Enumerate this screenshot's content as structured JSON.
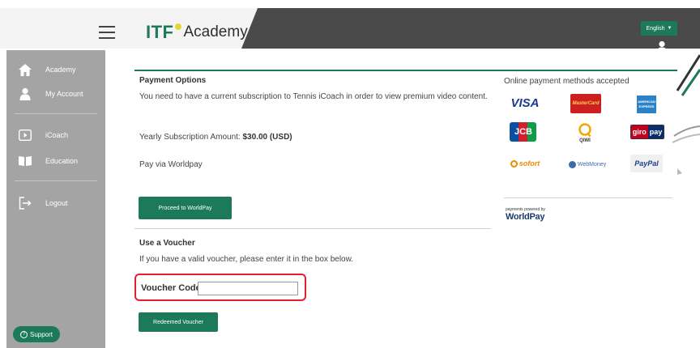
{
  "header": {
    "logo_itf": "ITF",
    "logo_academy": "Academy",
    "language": "English"
  },
  "sidebar": {
    "items": [
      {
        "label": "Academy",
        "icon": "home-icon"
      },
      {
        "label": "My Account",
        "icon": "user-icon"
      },
      {
        "label": "iCoach",
        "icon": "play-icon"
      },
      {
        "label": "Education",
        "icon": "book-icon"
      },
      {
        "label": "Logout",
        "icon": "logout-icon"
      }
    ],
    "support_label": "Support"
  },
  "payment": {
    "title": "Payment Options",
    "description": "You need to have a current subscription to Tennis iCoach in order to view premium video content.",
    "amount_label": "Yearly Subscription Amount: ",
    "amount_value": "$30.00 (USD)",
    "pay_via": "Pay via Worldpay",
    "proceed_button": "Proceed to WorldPay"
  },
  "methods": {
    "title": "Online payment methods accepted",
    "visa": "VISA",
    "mastercard": "MasterCard",
    "amex": "AMERICAN EXPRESS",
    "jcb": "JCB",
    "qiwi": "QIWI",
    "giro_a": "giro",
    "giro_b": "pay",
    "sofort": "sofort",
    "webmoney": "WebMoney",
    "paypal": "PayPal",
    "worldpay_small": "payments powered by",
    "worldpay": "WorldPay"
  },
  "voucher": {
    "title": "Use a Voucher",
    "description": "If you have a valid voucher, please enter it in the box below.",
    "code_label": "Voucher Code",
    "code_value": "",
    "redeem_button": "Redeemed Voucher"
  },
  "colors": {
    "brand_green": "#1c7a5a",
    "sidebar_gray": "#a4a4a4",
    "header_dark": "#4a4a4a",
    "highlight_red": "#e0202a"
  }
}
